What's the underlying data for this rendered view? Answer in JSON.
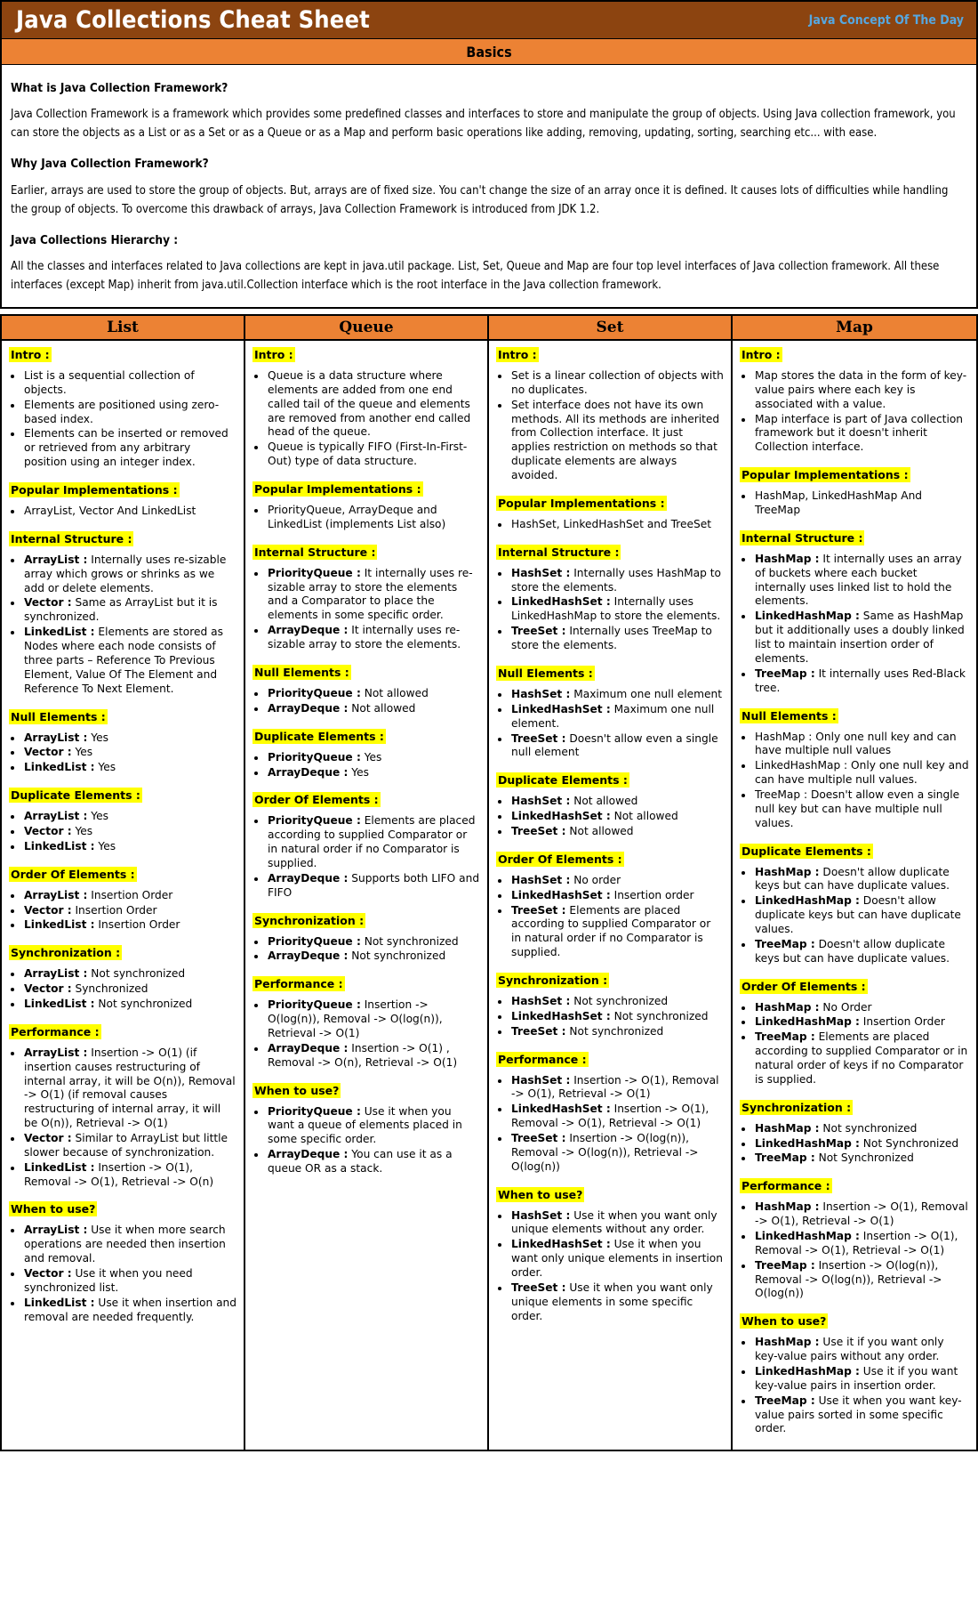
{
  "header": {
    "title": "Java Collections Cheat Sheet",
    "brand": "Java Concept Of The Day",
    "bar_color": "#8c4410",
    "brand_color": "#56a7e0"
  },
  "basics": {
    "band_label": "Basics",
    "band_color": "#ec8234",
    "q1_heading": "What is Java Collection Framework?",
    "q1_text": "Java Collection Framework is a framework which provides some predefined classes and interfaces to store and manipulate the group of objects. Using Java collection framework, you can store the objects as a List or as a Set or as a Queue or as a Map and perform basic operations like adding, removing, updating, sorting, searching etc... with ease.",
    "q2_heading": "Why Java Collection Framework?",
    "q2_text": "Earlier, arrays are used to store the group of objects. But, arrays are of fixed size. You can't change the size of an array once it is defined. It causes lots of difficulties while handling the group of objects. To overcome this drawback of arrays, Java Collection Framework is introduced from JDK 1.2.",
    "q3_heading": "Java Collections Hierarchy :",
    "q3_text": "All the classes and interfaces related to Java collections are kept in java.util package. List, Set, Queue and Map are four top level interfaces of Java collection framework. All these interfaces (except Map) inherit from java.util.Collection interface which is the root interface in the Java collection framework."
  },
  "columns": [
    {
      "header": "List",
      "sections": [
        {
          "title": "Intro :",
          "items": [
            {
              "text": "List is a sequential collection of objects."
            },
            {
              "text": "Elements are positioned using zero-based index."
            },
            {
              "text": "Elements can be inserted or removed or retrieved from any arbitrary position using an integer index."
            }
          ]
        },
        {
          "title": "Popular Implementations :",
          "items": [
            {
              "text": "ArrayList, Vector And LinkedList"
            }
          ]
        },
        {
          "title": "Internal Structure :",
          "items": [
            {
              "label": "ArrayList :",
              "text": " Internally uses re-sizable array which grows or shrinks as we add or delete elements."
            },
            {
              "label": "Vector :",
              "text": " Same as ArrayList but it is synchronized."
            },
            {
              "label": "LinkedList :",
              "text": " Elements are stored as Nodes where each node consists of three parts – Reference To Previous Element, Value Of The Element and Reference To Next Element."
            }
          ]
        },
        {
          "title": "Null Elements :",
          "items": [
            {
              "label": "ArrayList :",
              "text": " Yes"
            },
            {
              "label": "Vector :",
              "text": " Yes"
            },
            {
              "label": "LinkedList :",
              "text": " Yes"
            }
          ]
        },
        {
          "title": "Duplicate Elements :",
          "items": [
            {
              "label": "ArrayList :",
              "text": " Yes"
            },
            {
              "label": "Vector :",
              "text": " Yes"
            },
            {
              "label": "LinkedList :",
              "text": " Yes"
            }
          ]
        },
        {
          "title": "Order Of Elements :",
          "items": [
            {
              "label": "ArrayList :",
              "text": " Insertion Order"
            },
            {
              "label": "Vector :",
              "text": " Insertion Order"
            },
            {
              "label": "LinkedList :",
              "text": " Insertion Order"
            }
          ]
        },
        {
          "title": "Synchronization :",
          "items": [
            {
              "label": "ArrayList :",
              "text": " Not synchronized"
            },
            {
              "label": "Vector :",
              "text": " Synchronized"
            },
            {
              "label": "LinkedList :",
              "text": " Not synchronized"
            }
          ]
        },
        {
          "title": "Performance :",
          "items": [
            {
              "label": "ArrayList :",
              "text": " Insertion -> O(1) (if insertion causes restructuring of internal array, it will be O(n)), Removal -> O(1) (if removal causes restructuring of internal array, it will be O(n)), Retrieval -> O(1)"
            },
            {
              "label": "Vector :",
              "text": " Similar to ArrayList but little slower because of synchronization."
            },
            {
              "label": "LinkedList :",
              "text": " Insertion -> O(1), Removal -> O(1), Retrieval -> O(n)"
            }
          ]
        },
        {
          "title": "When to use?",
          "items": [
            {
              "label": "ArrayList :",
              "text": " Use it when more search operations are needed then insertion and removal."
            },
            {
              "label": "Vector :",
              "text": " Use it when you need synchronized list."
            },
            {
              "label": "LinkedList :",
              "text": " Use it when insertion and removal are needed frequently."
            }
          ]
        }
      ]
    },
    {
      "header": "Queue",
      "sections": [
        {
          "title": "Intro :",
          "items": [
            {
              "text": "Queue is a data structure where elements are added from one end called tail of the queue and elements are removed from another end called head of the queue."
            },
            {
              "text": "Queue is typically FIFO (First-In-First-Out) type of data structure."
            }
          ]
        },
        {
          "title": "Popular Implementations :",
          "items": [
            {
              "text": "PriorityQueue, ArrayDeque and LinkedList (implements List also)"
            }
          ]
        },
        {
          "title": "Internal Structure :",
          "items": [
            {
              "label": "PriorityQueue :",
              "text": " It internally uses re-sizable array to store the elements and a Comparator to place the elements in some specific order."
            },
            {
              "label": "ArrayDeque :",
              "text": " It internally uses re-sizable array to store the elements."
            }
          ]
        },
        {
          "title": "Null Elements :",
          "items": [
            {
              "label": "PriorityQueue :",
              "text": " Not allowed"
            },
            {
              "label": "ArrayDeque :",
              "text": " Not allowed"
            }
          ]
        },
        {
          "title": "Duplicate Elements :",
          "items": [
            {
              "label": "PriorityQueue :",
              "text": " Yes"
            },
            {
              "label": "ArrayDeque :",
              "text": " Yes"
            }
          ]
        },
        {
          "title": "Order Of Elements :",
          "items": [
            {
              "label": "PriorityQueue :",
              "text": " Elements are placed according to supplied Comparator or in natural order if no Comparator is supplied."
            },
            {
              "label": "ArrayDeque :",
              "text": " Supports both LIFO and FIFO"
            }
          ]
        },
        {
          "title": "Synchronization :",
          "items": [
            {
              "label": "PriorityQueue :",
              "text": " Not synchronized"
            },
            {
              "label": "ArrayDeque :",
              "text": " Not synchronized"
            }
          ]
        },
        {
          "title": "Performance :",
          "items": [
            {
              "label": "PriorityQueue :",
              "text": " Insertion -> O(log(n)), Removal -> O(log(n)), Retrieval -> O(1)"
            },
            {
              "label": "ArrayDeque :",
              "text": " Insertion -> O(1) , Removal -> O(n), Retrieval -> O(1)"
            }
          ]
        },
        {
          "title": "When to use?",
          "items": [
            {
              "label": "PriorityQueue :",
              "text": " Use it when you want a queue of elements placed in some specific order."
            },
            {
              "label": "ArrayDeque :",
              "text": " You can use it as a queue OR as a stack."
            }
          ]
        }
      ]
    },
    {
      "header": "Set",
      "sections": [
        {
          "title": "Intro :",
          "items": [
            {
              "text": "Set is a linear collection of objects with no duplicates."
            },
            {
              "text": "Set interface does not have its own methods. All its methods are inherited from Collection interface. It just applies restriction on methods so that duplicate elements are always avoided."
            }
          ]
        },
        {
          "title": "Popular Implementations :",
          "items": [
            {
              "text": "HashSet, LinkedHashSet and TreeSet"
            }
          ]
        },
        {
          "title": "Internal Structure :",
          "items": [
            {
              "label": "HashSet :",
              "text": " Internally uses HashMap to store the elements."
            },
            {
              "label": "LinkedHashSet :",
              "text": " Internally uses LinkedHashMap to store the elements."
            },
            {
              "label": "TreeSet :",
              "text": " Internally uses TreeMap to store the elements."
            }
          ]
        },
        {
          "title": "Null Elements :",
          "items": [
            {
              "label": "HashSet :",
              "text": " Maximum one null element"
            },
            {
              "label": "LinkedHashSet :",
              "text": " Maximum one null element."
            },
            {
              "label": "TreeSet :",
              "text": " Doesn't allow even a single null element"
            }
          ]
        },
        {
          "title": "Duplicate Elements :",
          "items": [
            {
              "label": "HashSet :",
              "text": " Not allowed"
            },
            {
              "label": "LinkedHashSet :",
              "text": " Not allowed"
            },
            {
              "label": "TreeSet :",
              "text": " Not allowed"
            }
          ]
        },
        {
          "title": "Order Of Elements :",
          "items": [
            {
              "label": "HashSet :",
              "text": " No order"
            },
            {
              "label": "LinkedHashSet :",
              "text": " Insertion order"
            },
            {
              "label": "TreeSet :",
              "text": " Elements are placed according to supplied Comparator or in natural order if no Comparator is supplied."
            }
          ]
        },
        {
          "title": "Synchronization :",
          "items": [
            {
              "label": "HashSet :",
              "text": " Not synchronized"
            },
            {
              "label": "LinkedHashSet :",
              "text": " Not synchronized"
            },
            {
              "label": "TreeSet :",
              "text": " Not synchronized"
            }
          ]
        },
        {
          "title": "Performance :",
          "items": [
            {
              "label": "HashSet :",
              "text": " Insertion -> O(1), Removal -> O(1), Retrieval -> O(1)"
            },
            {
              "label": "LinkedHashSet :",
              "text": " Insertion -> O(1), Removal -> O(1), Retrieval -> O(1)"
            },
            {
              "label": "TreeSet :",
              "text": " Insertion -> O(log(n)), Removal -> O(log(n)),  Retrieval -> O(log(n))"
            }
          ]
        },
        {
          "title": "When to use?",
          "items": [
            {
              "label": "HashSet :",
              "text": " Use it when you want only unique elements without any order."
            },
            {
              "label": "LinkedHashSet :",
              "text": " Use it when you want only unique elements in insertion order."
            },
            {
              "label": "TreeSet :",
              "text": " Use it when you want only unique elements in some specific order."
            }
          ]
        }
      ]
    },
    {
      "header": "Map",
      "sections": [
        {
          "title": "Intro :",
          "items": [
            {
              "text": "Map stores the data in the form of key-value pairs where each key is associated with a value."
            },
            {
              "text": "Map interface is part of Java collection framework but it doesn't inherit Collection interface."
            }
          ]
        },
        {
          "title": "Popular Implementations :",
          "items": [
            {
              "text": "HashMap, LinkedHashMap And TreeMap"
            }
          ]
        },
        {
          "title": "Internal Structure :",
          "items": [
            {
              "label": "HashMap :",
              "text": " It internally uses an array of buckets where each bucket internally uses linked list to hold the elements."
            },
            {
              "label": "LinkedHashMap :",
              "text": " Same as HashMap but it additionally uses a doubly linked list to maintain insertion order of elements."
            },
            {
              "label": "TreeMap :",
              "text": " It internally uses Red-Black tree."
            }
          ]
        },
        {
          "title": "Null Elements :",
          "items": [
            {
              "text": "HashMap : Only one null key and can have multiple null values"
            },
            {
              "text": "LinkedHashMap : Only one null key and can have multiple null values."
            },
            {
              "text": "TreeMap : Doesn't allow even a single null key but can have multiple null values."
            }
          ]
        },
        {
          "title": "Duplicate Elements :",
          "items": [
            {
              "label": "HashMap :",
              "text": " Doesn't allow duplicate keys but can have duplicate values."
            },
            {
              "label": "LinkedHashMap :",
              "text": " Doesn't allow duplicate keys but can have duplicate values."
            },
            {
              "label": "TreeMap :",
              "text": " Doesn't allow duplicate keys but can have duplicate values."
            }
          ]
        },
        {
          "title": "Order Of Elements :",
          "items": [
            {
              "label": "HashMap :",
              "text": " No Order"
            },
            {
              "label": "LinkedHashMap :",
              "text": " Insertion Order"
            },
            {
              "label": "TreeMap :",
              "text": " Elements are placed according to supplied Comparator or in natural order of keys if no Comparator is supplied."
            }
          ]
        },
        {
          "title": "Synchronization :",
          "items": [
            {
              "label": "HashMap :",
              "text": " Not synchronized"
            },
            {
              "label": "LinkedHashMap :",
              "text": " Not Synchronized"
            },
            {
              "label": "TreeMap :",
              "text": " Not Synchronized"
            }
          ]
        },
        {
          "title": "Performance :",
          "items": [
            {
              "label": "HashMap :",
              "text": " Insertion -> O(1), Removal -> O(1), Retrieval -> O(1)"
            },
            {
              "label": "LinkedHashMap :",
              "text": " Insertion -> O(1), Removal -> O(1),  Retrieval -> O(1)"
            },
            {
              "label": "TreeMap :",
              "text": " Insertion -> O(log(n)), Removal -> O(log(n)), Retrieval -> O(log(n))"
            }
          ]
        },
        {
          "title": "When to use?",
          "items": [
            {
              "label": "HashMap :",
              "text": " Use it if you want only key-value pairs without any order."
            },
            {
              "label": "LinkedHashMap :",
              "text": " Use it if you want key-value pairs in insertion order."
            },
            {
              "label": "TreeMap :",
              "text": " Use it when you want key-value pairs sorted in some specific order."
            }
          ]
        }
      ]
    }
  ]
}
